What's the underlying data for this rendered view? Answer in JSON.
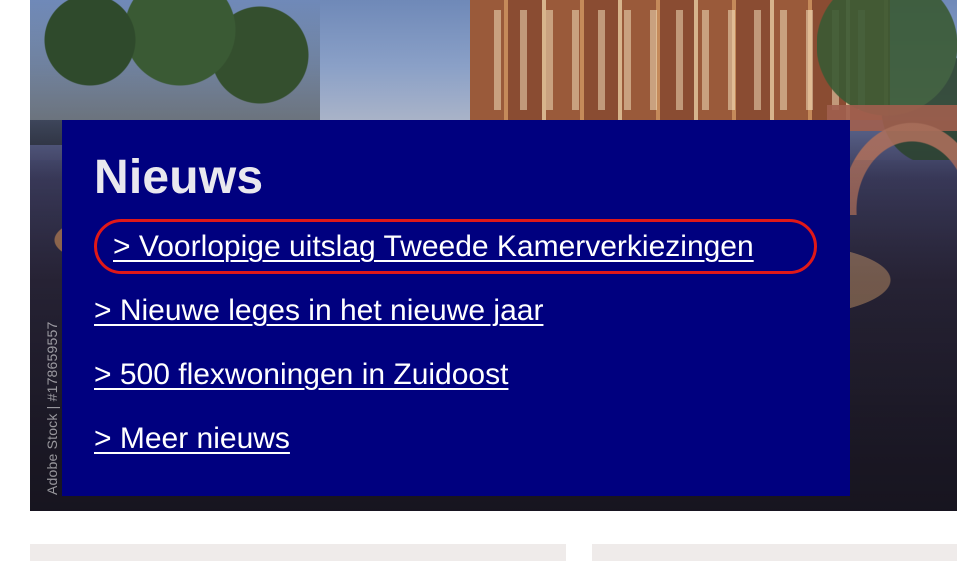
{
  "hero": {
    "watermark_text": "Adobe Stock | #178659557"
  },
  "news": {
    "title": "Nieuws",
    "items": [
      {
        "label": "> Voorlopige uitslag Tweede Kamerverkiezingen"
      },
      {
        "label": "> Nieuwe leges in het nieuwe jaar"
      },
      {
        "label": "> 500 flexwoningen in Zuidoost"
      },
      {
        "label": "> Meer nieuws"
      }
    ]
  },
  "colors": {
    "panel_background": "#00007f",
    "title_text": "#e9e8ee",
    "link_text": "#ffffff",
    "focus_ring": "#e01818",
    "bottom_card": "#efebea"
  }
}
